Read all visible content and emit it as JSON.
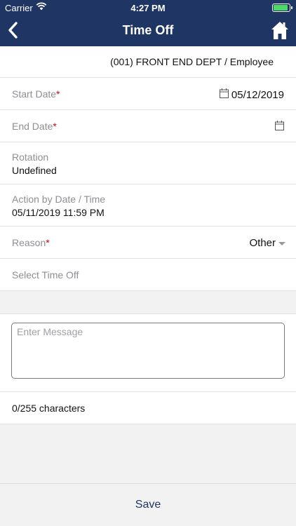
{
  "status_bar": {
    "carrier": "Carrier",
    "time": "4:27 PM"
  },
  "nav": {
    "title": "Time Off"
  },
  "form": {
    "department": "(001) FRONT END DEPT / Employee",
    "start_date": {
      "label": "Start Date",
      "required": "*",
      "value": "05/12/2019"
    },
    "end_date": {
      "label": "End Date",
      "required": "*",
      "value": ""
    },
    "rotation": {
      "label": "Rotation",
      "value": "Undefined"
    },
    "action_by": {
      "label": "Action by Date / Time",
      "value": "05/11/2019 11:59 PM"
    },
    "reason": {
      "label": "Reason",
      "required": "*",
      "value": "Other"
    },
    "select_time_off": {
      "label": "Select Time Off"
    },
    "message": {
      "placeholder": "Enter Message",
      "value": ""
    },
    "char_count": "0/255 characters"
  },
  "footer": {
    "save_label": "Save"
  },
  "colors": {
    "header_bg": "#1f3564",
    "required": "#d0021b",
    "battery": "#4cd964"
  }
}
